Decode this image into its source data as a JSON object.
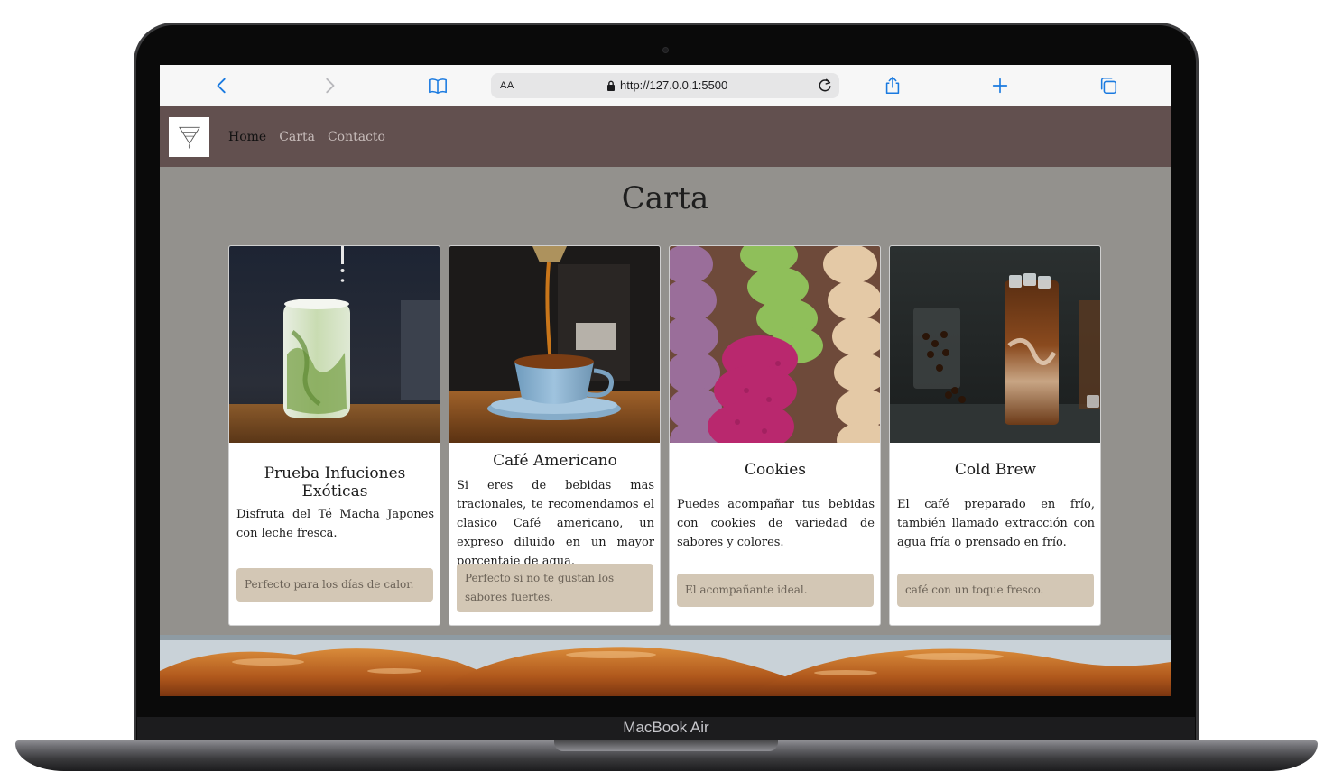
{
  "device": {
    "model_label": "MacBook Air"
  },
  "browser": {
    "text_size_label": "AA",
    "url": "http://127.0.0.1:5500",
    "icons": [
      "chevron-left-icon",
      "chevron-right-icon",
      "book-icon",
      "lock-icon",
      "reload-icon",
      "share-icon",
      "plus-icon",
      "tabs-icon"
    ]
  },
  "site": {
    "logo_icon": "funnel-drip-logo",
    "nav": [
      {
        "label": "Home",
        "active": true
      },
      {
        "label": "Carta",
        "active": false
      },
      {
        "label": "Contacto",
        "active": false
      }
    ],
    "heading": "Carta",
    "cards": [
      {
        "image": "matcha-latte-photo",
        "title": "Prueba Infuciones Exóticas",
        "text": "Disfruta del Té Macha Japones con leche fresca.",
        "footer": "Perfecto para los días de calor."
      },
      {
        "image": "americano-pour-photo",
        "title": "Café Americano",
        "text": "Si eres de bebidas mas tracionales, te recomendamos el clasico Café americano, un expreso diluido en un mayor porcentaje de agua.",
        "footer": "Perfecto si no te gustan los sabores fuertes."
      },
      {
        "image": "cookies-photo",
        "title": "Cookies",
        "text": "Puedes acompañar tus bebidas con cookies de variedad de sabores y colores.",
        "footer": "El acompañante ideal."
      },
      {
        "image": "cold-brew-photo",
        "title": "Cold Brew",
        "text": "El café preparado en frío, también llamado extracción con agua fría o prensado en frío.",
        "footer": "café con un toque fresco."
      }
    ],
    "banner_image": "croissants-photo"
  },
  "colors": {
    "nav_bg": "#62504f",
    "page_bg": "#93918d",
    "card_footer_bg": "#d3c7b5",
    "browser_accent": "#1a7ae0"
  }
}
